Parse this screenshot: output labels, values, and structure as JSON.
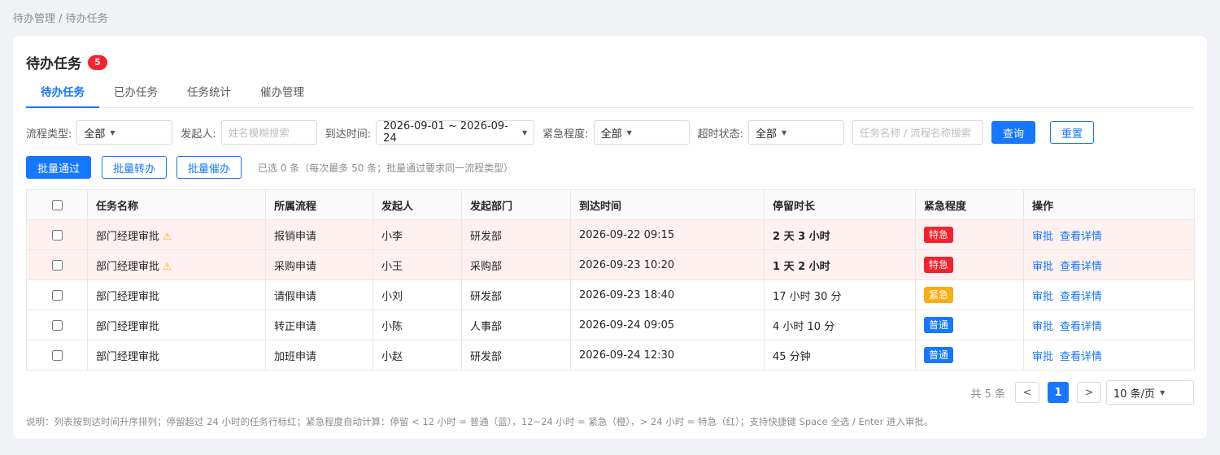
{
  "breadcrumb": "待办管理 / 待办任务",
  "header": {
    "title": "待办任务",
    "count": "5"
  },
  "tabs": [
    {
      "label": "待办任务",
      "active": true
    },
    {
      "label": "已办任务",
      "active": false
    },
    {
      "label": "任务统计",
      "active": false
    },
    {
      "label": "催办管理",
      "active": false
    }
  ],
  "filters": {
    "process_type_label": "流程类型:",
    "process_type_value": "全部",
    "initiator_label": "发起人:",
    "initiator_placeholder": "姓名模糊搜索",
    "arrival_label": "到达时间:",
    "arrival_value": "2026-09-01 ~ 2026-09-24",
    "urgency_label": "紧急程度:",
    "urgency_value": "全部",
    "overtime_label": "超时状态:",
    "overtime_value": "全部",
    "keyword_placeholder": "任务名称 / 流程名称搜索",
    "query_label": "查询",
    "reset_label": "重置"
  },
  "actions": {
    "batch_approve": "批量通过",
    "batch_transfer": "批量转办",
    "batch_remind": "批量催办",
    "selection_hint": "已选 0 条（每次最多 50 条；批量通过要求同一流程类型）"
  },
  "table": {
    "headers": [
      "任务名称",
      "所属流程",
      "发起人",
      "发起部门",
      "到达时间",
      "停留时长",
      "紧急程度",
      "操作"
    ],
    "approve_label": "审批",
    "detail_label": "查看详情",
    "rows": [
      {
        "task": "部门经理审批",
        "process": "报销申请",
        "initiator": "小李",
        "dept": "研发部",
        "arrival": "2026-09-22 09:15",
        "stay": "2 天 3 小时",
        "urgency": "特急",
        "urgency_color": "#f5222d"
      },
      {
        "task": "部门经理审批",
        "process": "采购申请",
        "initiator": "小王",
        "dept": "采购部",
        "arrival": "2026-09-23 10:20",
        "stay": "1 天 2 小时",
        "urgency": "特急",
        "urgency_color": "#f5222d"
      },
      {
        "task": "部门经理审批",
        "process": "请假申请",
        "initiator": "小刘",
        "dept": "研发部",
        "arrival": "2026-09-23 18:40",
        "stay": "17 小时 30 分",
        "urgency": "紧急",
        "urgency_color": "#faad14"
      },
      {
        "task": "部门经理审批",
        "process": "转正申请",
        "initiator": "小陈",
        "dept": "人事部",
        "arrival": "2026-09-24 09:05",
        "stay": "4 小时 10 分",
        "urgency": "普通",
        "urgency_color": "#1677ff"
      },
      {
        "task": "部门经理审批",
        "process": "加班申请",
        "initiator": "小赵",
        "dept": "研发部",
        "arrival": "2026-09-24 12:30",
        "stay": "45 分钟",
        "urgency": "普通",
        "urgency_color": "#1677ff"
      }
    ]
  },
  "pagination": {
    "total": "共 5 条",
    "prev": "<",
    "current": "1",
    "next": ">",
    "page_size": "10 条/页"
  },
  "note": "说明：列表按到达时间升序排列；停留超过 24 小时的任务行标红；紧急程度自动计算：停留 < 12 小时 = 普通（蓝），12~24 小时 = 紧急（橙），> 24 小时 = 特急（红）；支持快捷键 Space 全选 / Enter 进入审批。"
}
